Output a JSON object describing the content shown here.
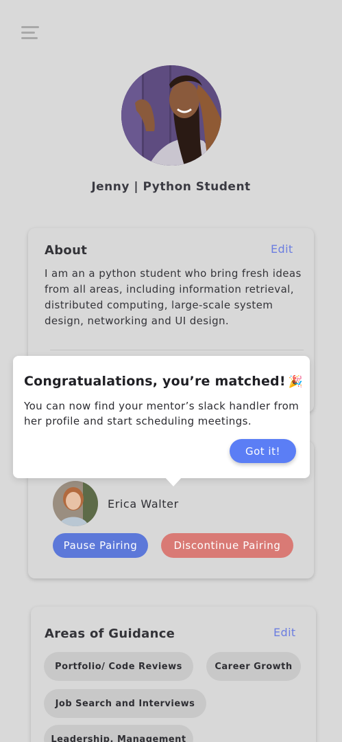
{
  "profile": {
    "name": "Jenny | Python Student"
  },
  "about": {
    "title": "About",
    "edit_label": "Edit",
    "text": "I am an a python student who bring fresh ideas from all areas, including information retrieval, distributed computing, large-scale system design, networking and UI design."
  },
  "popup": {
    "title": "Congratualations, you’re matched!",
    "emoji": "🎉",
    "text": "You can now find your mentor’s slack handler from her profile and start scheduling meetings.",
    "button_label": "Got it!"
  },
  "mentor": {
    "name": "Erica Walter",
    "pause_label": "Pause Pairing",
    "discontinue_label": "Discontinue Pairing"
  },
  "guidance": {
    "title": "Areas of Guidance",
    "edit_label": "Edit",
    "tags": [
      "Portfolio/ Code Reviews",
      "Career Growth",
      "Job Search and Interviews",
      "Leadership, Management"
    ]
  },
  "colors": {
    "background": "#d9d9d9",
    "primary_button": "#5b7ef5",
    "pause_button": "#5c78d9",
    "discontinue_button": "#d97a75",
    "edit_link": "#6b7de0"
  },
  "icons": {
    "menu": "hamburger-menu-icon",
    "celebration": "party-popper-icon"
  }
}
